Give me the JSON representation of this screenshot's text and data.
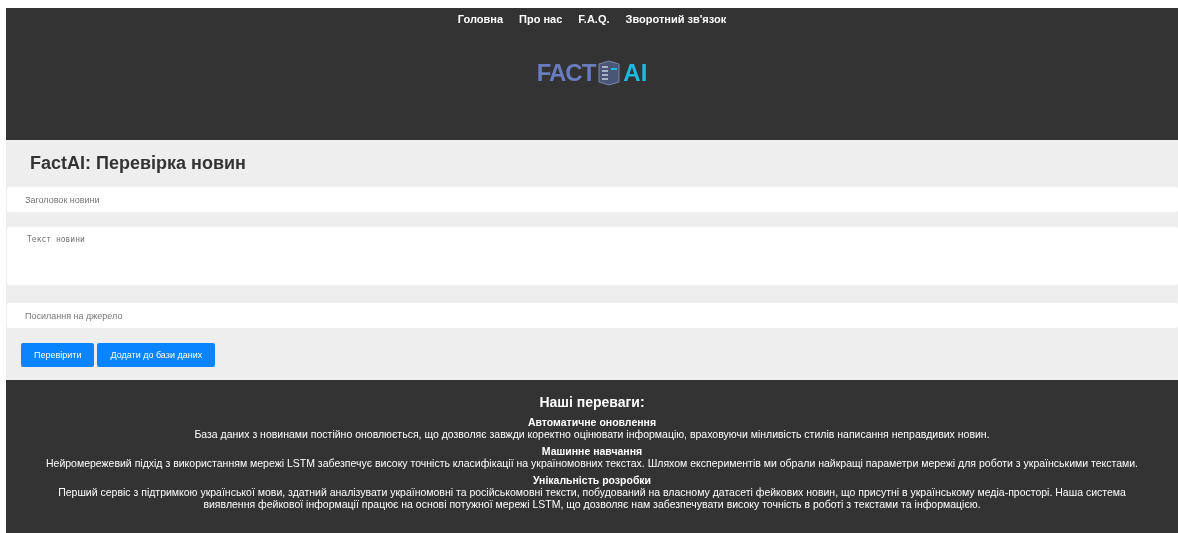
{
  "nav": [
    "Головна",
    "Про нас",
    "F.A.Q.",
    "Зворотний зв'язок"
  ],
  "logo": {
    "left": "FACT",
    "right": "AI"
  },
  "form": {
    "title": "FactAI: Перевірка новин",
    "fields": [
      {
        "kind": "input",
        "placeholder": "Заголовок новини"
      },
      {
        "kind": "textarea",
        "placeholder": "Текст новини"
      },
      {
        "kind": "input",
        "placeholder": "Посилання на джерело"
      }
    ],
    "buttons": [
      "Перевірити",
      "Додати до бази даних"
    ]
  },
  "advantages": {
    "title": "Наші переваги:",
    "items": [
      {
        "heading": "Автоматичне оновлення",
        "text": "База даних з новинами постійно оновлюється, що дозволяє завжди коректно оцінювати інформацію, враховуючи мінливість стилів написання неправдивих новин."
      },
      {
        "heading": "Машинне навчання",
        "text": "Нейромережевий підхід з використанням мережі LSTM забезпечує високу точність класифікації на україномовних текстах. Шляхом експериментів ми обрали найкращі параметри мережі для роботи з українськими текстами."
      },
      {
        "heading": "Унікальність розробки",
        "text": "Перший сервіс з підтримкою української мови, здатний аналізувати україномовні та російськомовні тексти, побудований на власному датасеті фейкових новин, що присутні в українському медіа-просторі. Наша система виявлення фейкової інформації працює на основі потужної мережі LSTM, що дозволяє нам забезпечувати високу точність в роботі з текстами та інформацією."
      }
    ]
  }
}
